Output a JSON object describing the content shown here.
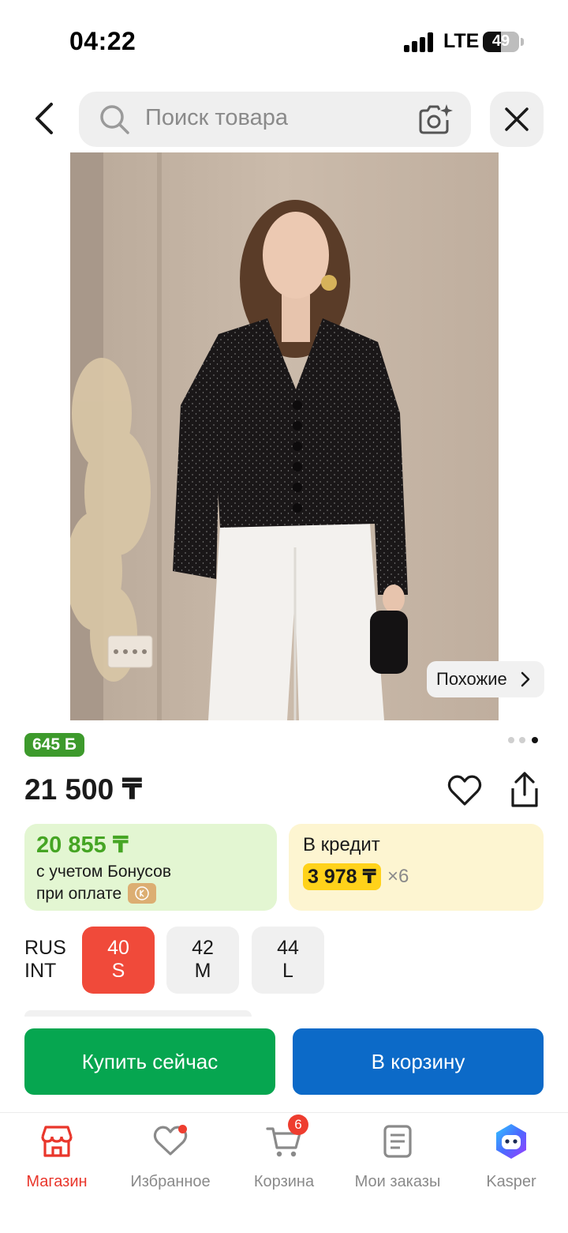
{
  "status_bar": {
    "time": "04:22",
    "network": "LTE",
    "battery": "49",
    "battery_level": 0.49
  },
  "header": {
    "search_placeholder": "Поиск товара",
    "icons": {
      "back": "chevron-left-icon",
      "search": "search-icon",
      "camera": "camera-ai-icon",
      "close": "close-icon"
    }
  },
  "product": {
    "image_alt_icon": "product-photo",
    "similar_label": "Похожие",
    "image_page_count": 3,
    "image_page_active": 3,
    "bonus_badge": "645 Б",
    "price": "21 500 ₸"
  },
  "offers": {
    "bonus_price": "20 855 ₸",
    "bonus_line1": "с учетом Бонусов",
    "bonus_line2": "при оплате",
    "credit_title": "В кредит",
    "credit_amount": "3 978 ₸",
    "credit_multiplier": "×6"
  },
  "sizes": {
    "system_label_1": "RUS",
    "system_label_2": "INT",
    "options": [
      {
        "rus": "40",
        "int": "S",
        "selected": true
      },
      {
        "rus": "42",
        "int": "M",
        "selected": false
      },
      {
        "rus": "44",
        "int": "L",
        "selected": false
      }
    ]
  },
  "actions": {
    "buy_now": "Купить сейчас",
    "add_to_cart": "В корзину"
  },
  "bottom_nav": {
    "items": [
      {
        "label": "Магазин",
        "icon": "shop-icon",
        "active": true
      },
      {
        "label": "Избранное",
        "icon": "heart-icon",
        "active": false
      },
      {
        "label": "Корзина",
        "icon": "cart-icon",
        "active": false
      },
      {
        "label": "Мои заказы",
        "icon": "orders-icon",
        "active": false
      },
      {
        "label": "Kasper",
        "icon": "kasper-icon",
        "active": false
      }
    ],
    "cart_count": "6"
  },
  "colors": {
    "accent_red": "#f04a3a",
    "buy_green": "#06a650",
    "cart_blue": "#0c6ac8",
    "bonus_green": "#3d9a2c",
    "credit_yellow": "#ffd21a"
  }
}
